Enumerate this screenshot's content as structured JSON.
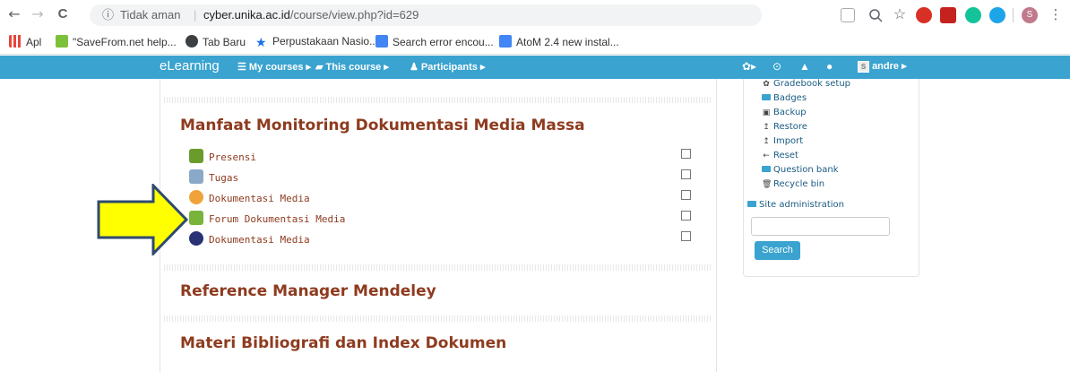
{
  "browser": {
    "back_glyph": "←",
    "forward_glyph": "→",
    "reload_glyph": "C",
    "info_glyph": "ⓘ",
    "security_label": "Tidak aman",
    "separator": "|",
    "url_domain": "cyber.unika.ac.id",
    "url_path": "/course/view.php?id=629",
    "menu_glyph": "⋮",
    "profile_initial": "S"
  },
  "bookmarks": [
    {
      "label": "Apl",
      "color": "#e8453c"
    },
    {
      "label": "\"SaveFrom.net help...",
      "color": "#7dc13a"
    },
    {
      "label": "Tab Baru",
      "color": "#3c4043"
    },
    {
      "label": "Perpustakaan Nasio...",
      "color": "#1a73e8"
    },
    {
      "label": "Search error encou...",
      "color": "#4285f4"
    },
    {
      "label": "AtoM 2.4 new instal...",
      "color": "#4285f4"
    }
  ],
  "navbar": {
    "brand": "eLearning",
    "items": [
      "My courses ▸",
      "This course ▸",
      "Participants ▸"
    ],
    "user_initial": "S",
    "username": "andre ▸",
    "color": "#3aa3cf"
  },
  "sections": [
    {
      "title": "Manfaat Monitoring Dokumentasi Media Massa",
      "activities": [
        {
          "label": "Presensi",
          "icon": "attendance-icon"
        },
        {
          "label": "Tugas",
          "icon": "assignment-icon"
        },
        {
          "label": "Dokumentasi Media",
          "icon": "chat-icon"
        },
        {
          "label": "Forum Dokumentasi Media",
          "icon": "forum-icon"
        },
        {
          "label": "Dokumentasi Media",
          "icon": "bigbluebutton-icon"
        }
      ]
    },
    {
      "title": "Reference Manager Mendeley"
    },
    {
      "title": "Materi Bibliografi dan Index Dokumen"
    }
  ],
  "admin_block": {
    "items": [
      {
        "glyph": "✿",
        "label": "Gradebook setup"
      },
      {
        "glyph": "folder",
        "label": "Badges"
      },
      {
        "glyph": "▣",
        "label": "Backup"
      },
      {
        "glyph": "↥",
        "label": "Restore"
      },
      {
        "glyph": "↥",
        "label": "Import"
      },
      {
        "glyph": "←",
        "label": "Reset"
      },
      {
        "glyph": "folder",
        "label": "Question bank"
      },
      {
        "glyph": "🗑",
        "label": "Recycle bin"
      }
    ],
    "site_admin": "Site administration",
    "search_label": "Search"
  }
}
